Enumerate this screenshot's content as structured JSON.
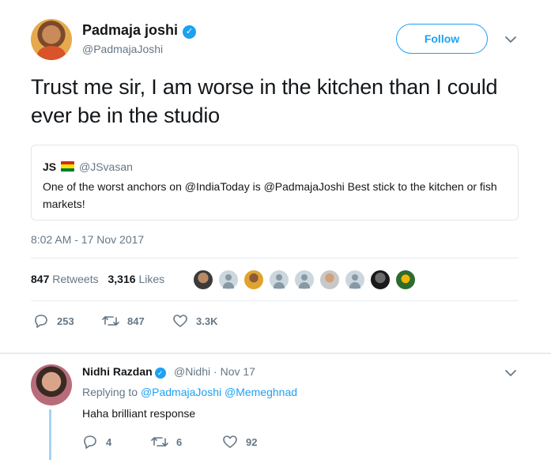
{
  "tweet": {
    "author": {
      "name": "Padmaja joshi",
      "handle": "@PadmajaJoshi",
      "verified_glyph": "✓"
    },
    "follow_label": "Follow",
    "text": "Trust me sir, I am worse in the kitchen than I could ever be in the studio",
    "quoted": {
      "name": "JS",
      "handle": "@JSvasan",
      "flag_icon": "bolivia-flag-icon",
      "text": "One of the worst anchors on @IndiaToday is @PadmajaJoshi Best stick to the kitchen or fish markets!"
    },
    "timestamp": "8:02 AM - 17 Nov 2017",
    "stats": {
      "retweets_count": "847",
      "retweets_label": "Retweets",
      "likes_count": "3,316",
      "likes_label": "Likes"
    },
    "actions": {
      "reply_count": "253",
      "retweet_count": "847",
      "like_count": "3.3K"
    }
  },
  "reply": {
    "author": {
      "name": "Nidhi Razdan",
      "handle": "@Nidhi",
      "date": "Nov 17",
      "verified_glyph": "✓"
    },
    "replying_prefix": "Replying to",
    "replying_to": [
      "@PadmajaJoshi",
      "@Memeghnad"
    ],
    "text": "Haha brilliant response",
    "actions": {
      "reply_count": "4",
      "retweet_count": "6",
      "like_count": "92"
    }
  },
  "colors": {
    "accent": "#1da1f2",
    "muted": "#657786",
    "text": "#14171a",
    "border": "#e6ecf0",
    "thread": "#a5d4f5"
  }
}
